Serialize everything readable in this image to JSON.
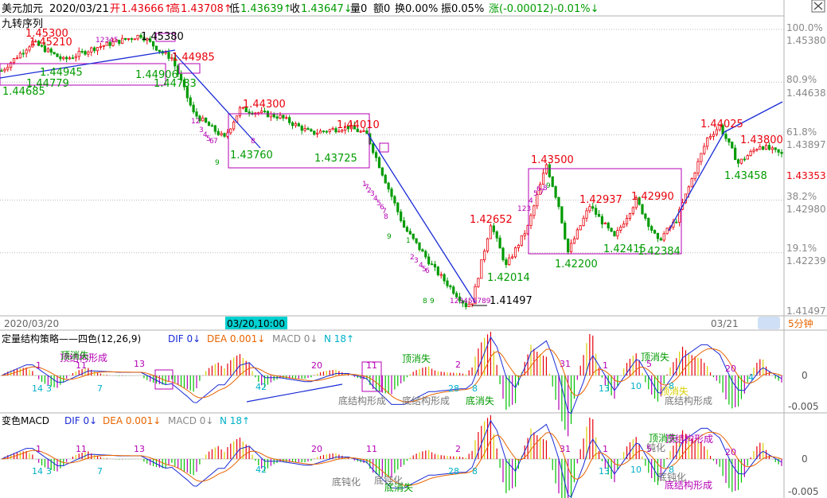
{
  "header": {
    "symbol": "美元加元",
    "date": "2020/03/21",
    "open_label": "开",
    "open": "1.43666↑",
    "high_label": "高",
    "high": "1.43708↑",
    "low_label": "低",
    "low": "1.43639↑",
    "close_label": "收",
    "close": "1.43647↓",
    "volume": "量0",
    "amount": "额0",
    "turnover": "换0.00%",
    "amplitude": "振0.05%",
    "change": "涨(-0.00012)-0.01%↓",
    "indicator_name": "九转序列"
  },
  "colors": {
    "up": "#e8000b",
    "down": "#009b00",
    "accent": "#b400b4",
    "blue": "#1a2bd6",
    "cyan": "#00c0d0",
    "orange": "#e86400",
    "yellow": "#d8d000",
    "grid": "#9a9a9a"
  },
  "main_axis": {
    "pct_labels": [
      "100.0%",
      "80.9%",
      "61.8%",
      "38.2%",
      "19.1%"
    ],
    "price_labels": [
      "1.45380",
      "1.44638",
      "1.43897",
      "1.42980",
      "1.42239",
      "1.41497"
    ],
    "current_price": "1.43353"
  },
  "time_axis": {
    "left_date": "2020/03/20",
    "cursor_time": "03/20,10:00",
    "right_date": "03/21",
    "period": "5分钟"
  },
  "main_annotations": {
    "high_labels": [
      "1.45300",
      "1.45210",
      "1.45380",
      "1.44985",
      "1.44300",
      "1.44010",
      "1.43500",
      "1.42652",
      "1.42937",
      "1.42990",
      "1.44025",
      "1.43800"
    ],
    "low_labels": [
      "1.44945",
      "1.44779",
      "1.44685",
      "1.44906",
      "1.44783",
      "1.43760",
      "1.43725",
      "1.42014",
      "1.42200",
      "1.42415",
      "1.42384",
      "1.43458",
      "1.41497"
    ],
    "nine_turn_counts": [
      "12",
      "3",
      "4",
      "5",
      "6",
      "7",
      "8",
      "9",
      "1",
      "2",
      "3",
      "4",
      "5",
      "6",
      "7",
      "8",
      "9",
      "1",
      "2",
      "3",
      "4",
      "5",
      "6",
      "7",
      "8",
      "9",
      "123",
      "4",
      "5",
      "6",
      "7",
      "8",
      "9",
      "123456789",
      "12345"
    ]
  },
  "panel1": {
    "title": "定量结构策略——四色(12,26,9)",
    "dif": "DIF 0↓",
    "dea": "DEA 0.001↓",
    "macd": "MACD 0↓",
    "n": "N 18↑",
    "axis_labels": [
      "0",
      "-0.005"
    ],
    "labels": [
      "顶消失",
      "顶结构形成",
      "顶消失",
      "顶消失",
      "顶消失",
      "底结构形成",
      "底结构形成",
      "底结构形成",
      "底消失",
      "底结构形成",
      "底结构形成"
    ],
    "counts": [
      "1",
      "11",
      "13",
      "14",
      "3",
      "7",
      "20",
      "42",
      "11",
      "2",
      "28",
      "8",
      "31",
      "1",
      "5",
      "13",
      "10",
      "8",
      "20",
      "4"
    ]
  },
  "panel2": {
    "title": "变色MACD",
    "dif": "DIF 0↓",
    "dea": "DEA 0.001↓",
    "macd": "MACD 0↓",
    "n": "N 18↑",
    "axis_labels": [
      "0",
      "-0.005"
    ],
    "labels": [
      "顶消失",
      "顶结构形成",
      "钝化",
      "底钝化",
      "底钝化",
      "底消失",
      "底钝化",
      "底结构形成"
    ],
    "counts": [
      "1",
      "11",
      "13",
      "14",
      "3",
      "7",
      "20",
      "42",
      "11",
      "2",
      "28",
      "8",
      "31",
      "1",
      "5",
      "13",
      "10",
      "8",
      "20"
    ]
  },
  "chart_data": {
    "type": "candlestick",
    "timeframe": "5分钟",
    "ylim": [
      1.41497,
      1.4538
    ],
    "fib_levels": [
      {
        "label": "100.0%",
        "price": 1.4538
      },
      {
        "label": "80.9%",
        "price": 1.44638
      },
      {
        "label": "61.8%",
        "price": 1.43897
      },
      {
        "label": "38.2%",
        "price": 1.4298
      },
      {
        "label": "19.1%",
        "price": 1.42239
      }
    ],
    "swing_points": [
      {
        "type": "high",
        "price": 1.453
      },
      {
        "type": "high",
        "price": 1.4521
      },
      {
        "type": "low",
        "price": 1.44945
      },
      {
        "type": "low",
        "price": 1.44779
      },
      {
        "type": "low",
        "price": 1.44685
      },
      {
        "type": "high",
        "price": 1.4538
      },
      {
        "type": "low",
        "price": 1.44906
      },
      {
        "type": "low",
        "price": 1.44783
      },
      {
        "type": "high",
        "price": 1.44985
      },
      {
        "type": "high",
        "price": 1.443
      },
      {
        "type": "low",
        "price": 1.4376
      },
      {
        "type": "low",
        "price": 1.43725
      },
      {
        "type": "high",
        "price": 1.4401
      },
      {
        "type": "low",
        "price": 1.41497
      },
      {
        "type": "high",
        "price": 1.42652
      },
      {
        "type": "low",
        "price": 1.42014
      },
      {
        "type": "high",
        "price": 1.435
      },
      {
        "type": "high",
        "price": 1.42937
      },
      {
        "type": "low",
        "price": 1.422
      },
      {
        "type": "high",
        "price": 1.4299
      },
      {
        "type": "low",
        "price": 1.42415
      },
      {
        "type": "low",
        "price": 1.42384
      },
      {
        "type": "high",
        "price": 1.44025
      },
      {
        "type": "high",
        "price": 1.438
      },
      {
        "type": "low",
        "price": 1.43458
      }
    ],
    "path_anchors": [
      [
        0,
        1.448
      ],
      [
        10,
        1.452
      ],
      [
        20,
        1.4495
      ],
      [
        30,
        1.4512
      ],
      [
        45,
        1.453
      ],
      [
        52,
        1.4505
      ],
      [
        55,
        1.4498
      ],
      [
        62,
        1.442
      ],
      [
        72,
        1.4385
      ],
      [
        77,
        1.4426
      ],
      [
        90,
        1.4415
      ],
      [
        100,
        1.4392
      ],
      [
        112,
        1.4401
      ],
      [
        118,
        1.439
      ],
      [
        130,
        1.426
      ],
      [
        140,
        1.42
      ],
      [
        150,
        1.415
      ],
      [
        152,
        1.4155
      ],
      [
        158,
        1.4265
      ],
      [
        163,
        1.4205
      ],
      [
        170,
        1.426
      ],
      [
        176,
        1.4348
      ],
      [
        180,
        1.429
      ],
      [
        183,
        1.4225
      ],
      [
        190,
        1.429
      ],
      [
        198,
        1.4245
      ],
      [
        205,
        1.4298
      ],
      [
        212,
        1.424
      ],
      [
        218,
        1.427
      ],
      [
        228,
        1.4385
      ],
      [
        232,
        1.4402
      ],
      [
        238,
        1.435
      ],
      [
        245,
        1.4375
      ],
      [
        252,
        1.4362
      ]
    ]
  }
}
